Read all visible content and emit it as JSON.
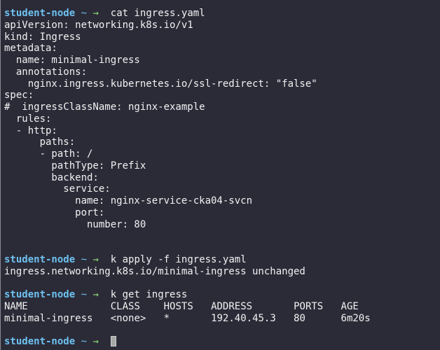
{
  "colors": {
    "background": "#2b2b38",
    "text": "#f2f2f2",
    "prompt_user": "#6ec1f0",
    "prompt_arrow": "#8ce07a",
    "cursor": "#a8a8a8"
  },
  "prompt": {
    "user": "student-node",
    "dir": "~",
    "arrow": "→"
  },
  "session": [
    {
      "command": "cat ingress.yaml",
      "output": [
        "apiVersion: networking.k8s.io/v1",
        "kind: Ingress",
        "metadata:",
        "  name: minimal-ingress",
        "  annotations:",
        "    nginx.ingress.kubernetes.io/ssl-redirect: \"false\"",
        "spec:",
        "#  ingressClassName: nginx-example",
        "  rules:",
        "  - http:",
        "      paths:",
        "      - path: /",
        "        pathType: Prefix",
        "        backend:",
        "          service:",
        "            name: nginx-service-cka04-svcn",
        "            port:",
        "              number: 80",
        "",
        ""
      ]
    },
    {
      "command": "k apply -f ingress.yaml",
      "output": [
        "ingress.networking.k8s.io/minimal-ingress unchanged",
        ""
      ]
    },
    {
      "command": "k get ingress",
      "table": {
        "columns": [
          "NAME",
          "CLASS",
          "HOSTS",
          "ADDRESS",
          "PORTS",
          "AGE"
        ],
        "rows": [
          [
            "minimal-ingress",
            "<none>",
            "*",
            "192.40.45.3",
            "80",
            "6m20s"
          ]
        ]
      },
      "output_after": [
        ""
      ]
    }
  ],
  "current_input": ""
}
